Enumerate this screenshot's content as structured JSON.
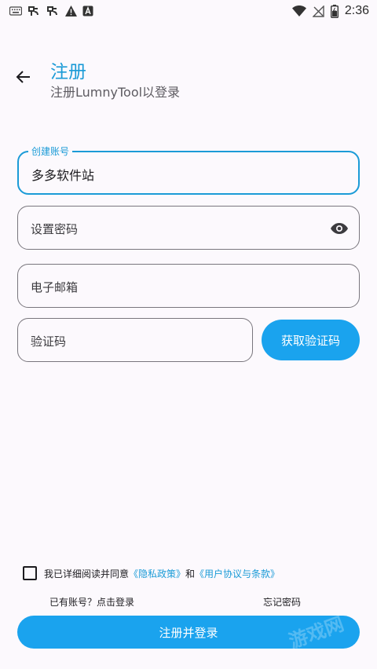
{
  "status_bar": {
    "time": "2:36",
    "icons": [
      "keyboard-icon",
      "app-icon",
      "app-icon",
      "warning-icon",
      "a-icon",
      "wifi-icon",
      "no-signal-icon",
      "battery-icon"
    ]
  },
  "header": {
    "title": "注册",
    "subtitle": "注册LumnyTool以登录"
  },
  "form": {
    "account_label": "创建账号",
    "account_value": "多多软件站",
    "password_placeholder": "设置密码",
    "email_placeholder": "电子邮箱",
    "code_placeholder": "验证码",
    "get_code_label": "获取验证码"
  },
  "agreement": {
    "prefix": "我已详细阅读并同意",
    "privacy_link": "《隐私政策》",
    "and": "和",
    "terms_link": "《用户协议与条款》"
  },
  "links": {
    "has_account": "已有账号？点击登录",
    "forgot_password": "忘记密码"
  },
  "submit_label": "注册并登录",
  "watermark_text": "游戏网",
  "colors": {
    "accent": "#1b9bd7",
    "button": "#1aa3ee",
    "background": "#fcf9fd",
    "outline": "#79767d"
  }
}
